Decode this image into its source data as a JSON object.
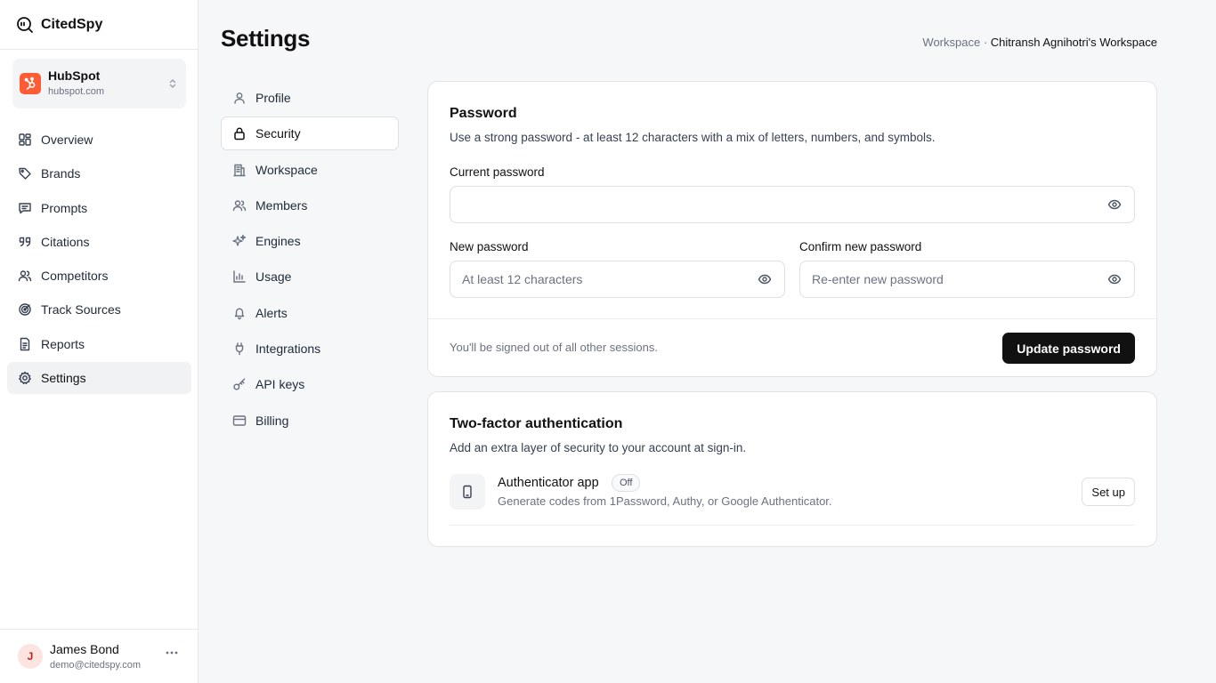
{
  "app": {
    "name": "CitedSpy",
    "logo_icon": "quote-radar-icon"
  },
  "workspace_switcher": {
    "name": "HubSpot",
    "domain": "hubspot.com",
    "logo_color": "#ff5c35"
  },
  "sidebar": {
    "items": [
      {
        "label": "Overview",
        "icon": "grid-icon"
      },
      {
        "label": "Brands",
        "icon": "tag-icon"
      },
      {
        "label": "Prompts",
        "icon": "message-icon"
      },
      {
        "label": "Citations",
        "icon": "quote-icon"
      },
      {
        "label": "Competitors",
        "icon": "users-icon"
      },
      {
        "label": "Track Sources",
        "icon": "target-icon"
      },
      {
        "label": "Reports",
        "icon": "document-icon"
      },
      {
        "label": "Settings",
        "icon": "gear-icon",
        "active": true
      }
    ]
  },
  "user": {
    "initial": "J",
    "name": "James Bond",
    "email": "demo@citedspy.com"
  },
  "header": {
    "title": "Settings",
    "breadcrumb_prefix": "Workspace",
    "breadcrumb_sep": " · ",
    "breadcrumb_workspace": "Chitransh Agnihotri's Workspace"
  },
  "settings_nav": {
    "items": [
      {
        "label": "Profile",
        "icon": "user-icon"
      },
      {
        "label": "Security",
        "icon": "lock-icon",
        "active": true
      },
      {
        "label": "Workspace",
        "icon": "building-icon"
      },
      {
        "label": "Members",
        "icon": "users-icon"
      },
      {
        "label": "Engines",
        "icon": "sparkles-icon"
      },
      {
        "label": "Usage",
        "icon": "bar-chart-icon"
      },
      {
        "label": "Alerts",
        "icon": "bell-icon"
      },
      {
        "label": "Integrations",
        "icon": "plug-icon"
      },
      {
        "label": "API keys",
        "icon": "key-icon"
      },
      {
        "label": "Billing",
        "icon": "credit-card-icon"
      }
    ]
  },
  "password": {
    "title": "Password",
    "description": "Use a strong password - at least 12 characters with a mix of letters, numbers, and symbols.",
    "current_label": "Current password",
    "current_value": "",
    "current_placeholder": "",
    "new_label": "New password",
    "new_placeholder": "At least 12 characters",
    "confirm_label": "Confirm new password",
    "confirm_placeholder": "Re-enter new password",
    "footer_note": "You'll be signed out of all other sessions.",
    "submit_label": "Update password"
  },
  "two_factor": {
    "title": "Two-factor authentication",
    "description": "Add an extra layer of security to your account at sign-in.",
    "method_title": "Authenticator app",
    "method_status": "Off",
    "method_description": "Generate codes from 1Password, Authy, or Google Authenticator.",
    "setup_label": "Set up"
  }
}
